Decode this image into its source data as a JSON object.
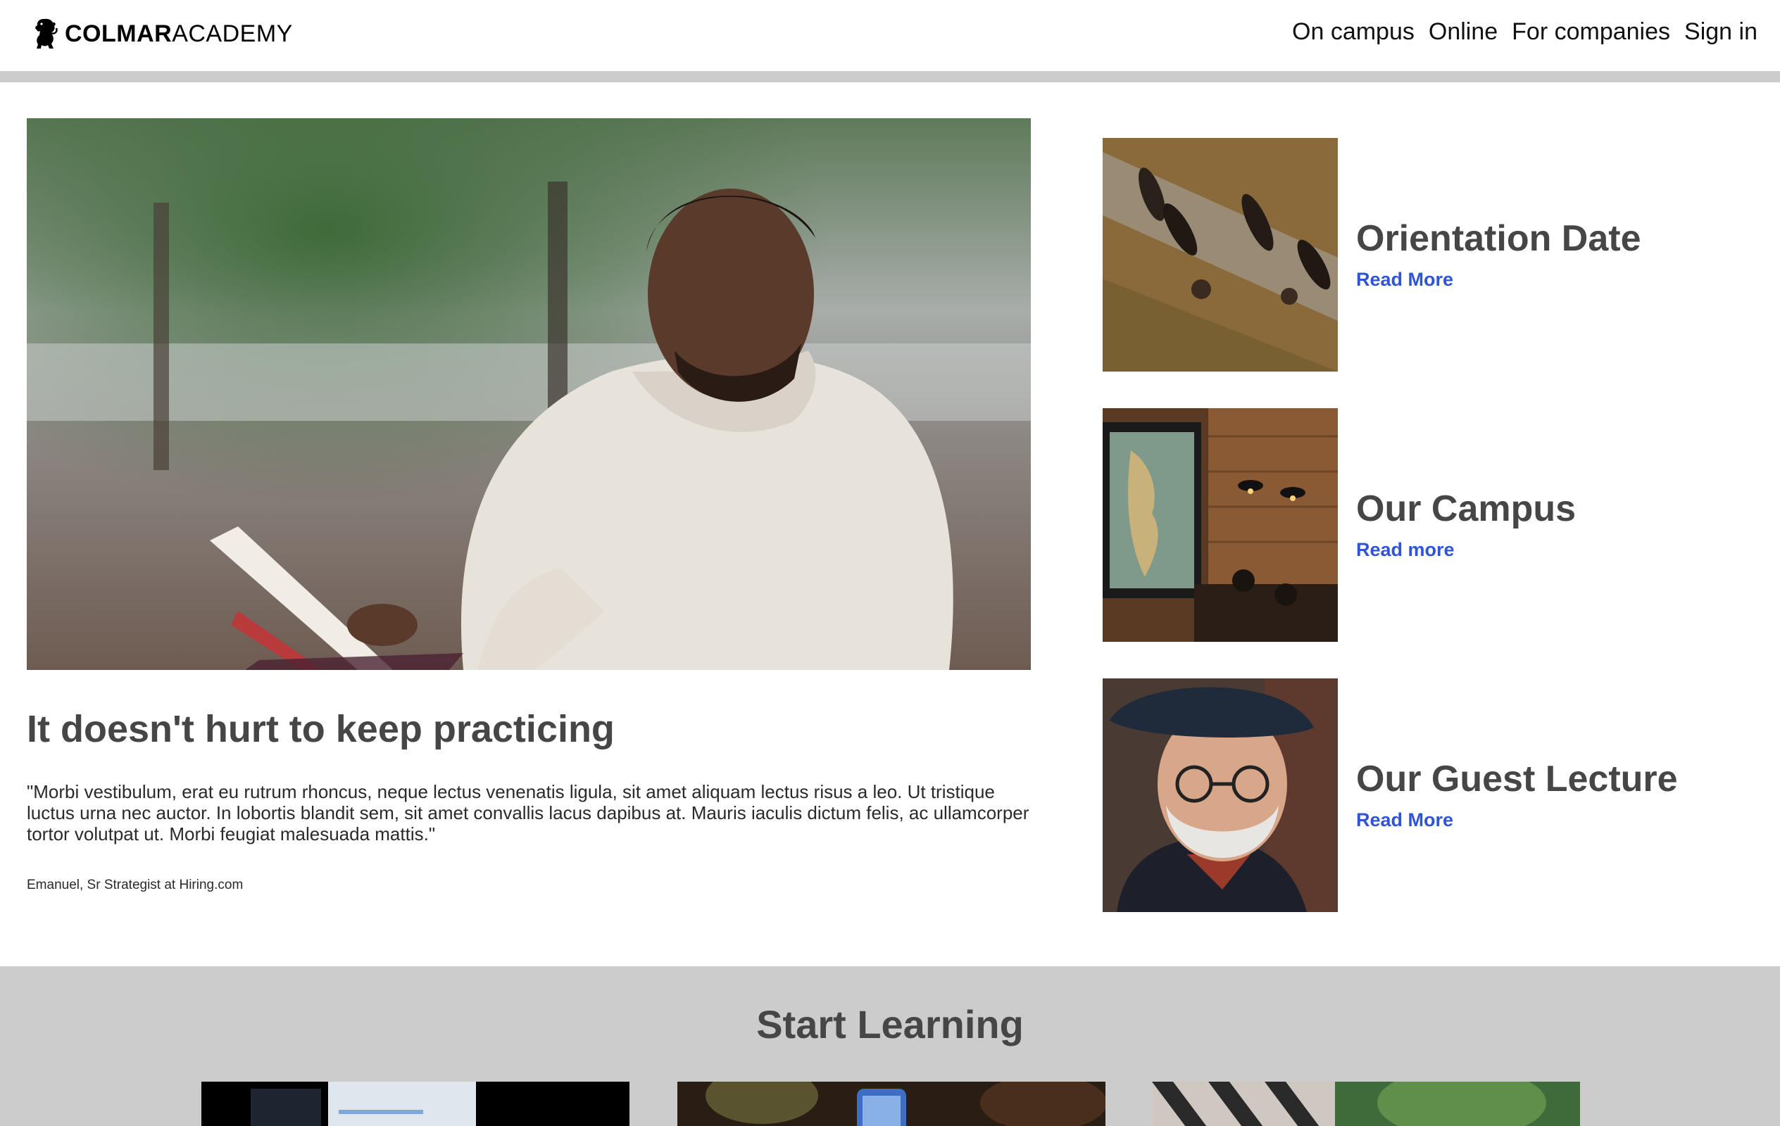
{
  "brand": {
    "name_bold": "COLMAR",
    "name_light": "ACADEMY",
    "logo_icon": "lion-rampant-icon"
  },
  "nav": {
    "items": [
      "On campus",
      "Online",
      "For companies",
      "Sign in"
    ]
  },
  "feature": {
    "image": "man-reading-book-outdoors",
    "title": "It doesn't hurt to keep practicing",
    "quote": "\"Morbi vestibulum, erat eu rutrum rhoncus, neque lectus venenatis ligula, sit amet aliquam lectus risus a leo. Ut tristique luctus urna nec auctor. In lobortis blandit sem, sit amet convallis lacus dapibus at. Mauris iaculis dictum felis, ac ullamcorper tortor volutpat ut. Morbi feugiat malesuada mattis.\"",
    "author": "Emanuel, Sr Strategist at Hiring.com"
  },
  "cards": [
    {
      "title": "Orientation Date",
      "link": "Read More",
      "image": "people-walking-shadows"
    },
    {
      "title": "Our Campus",
      "link": "Read more",
      "image": "cafe-with-world-map"
    },
    {
      "title": "Our Guest Lecture",
      "link": "Read More",
      "image": "bearded-man-in-beret"
    }
  ],
  "learning": {
    "title": "Start Learning",
    "courses": [
      "laptop-code-screen",
      "phone-in-hand",
      "outdoor-park"
    ]
  },
  "colors": {
    "link": "#2f54d6",
    "heading": "#464646",
    "bar_gray": "#cccccc"
  }
}
